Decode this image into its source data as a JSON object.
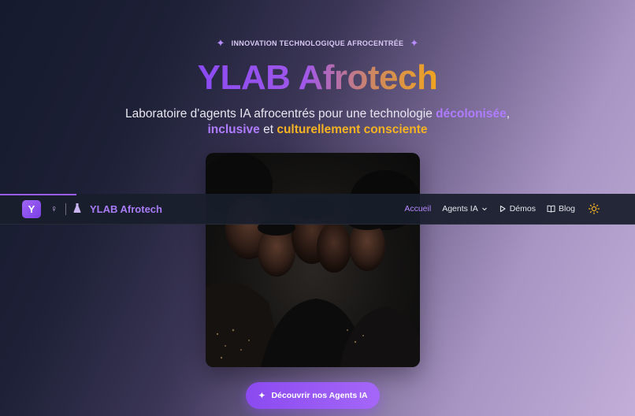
{
  "hero": {
    "eyebrow": "INNOVATION TECHNOLOGIQUE AFROCENTRÉE",
    "title": "YLAB Afrotech",
    "subtitle_part1": "Laboratoire d'agents IA afrocentrés pour une technologie ",
    "subtitle_highlight1": "décolonisée",
    "subtitle_part2": ",",
    "subtitle_highlight2": "inclusive",
    "subtitle_part3": " et ",
    "subtitle_highlight3": "culturellement consciente",
    "image_alt": "Groupe de personnes africaines en clair-obscur",
    "cta_label": "Découvrir nos Agents IA",
    "cta_icon": "sparkles-icon"
  },
  "navbar": {
    "logo_letter": "Y",
    "icon_female": "♀",
    "icon_flask": "♟",
    "brand": "YLAB Afrotech",
    "links": [
      {
        "label": "Accueil",
        "active": true
      },
      {
        "label": "Agents IA",
        "icon": "chevron-down-icon"
      },
      {
        "label": "Démos",
        "icon": "play-icon"
      },
      {
        "label": "Blog",
        "icon": "book-icon"
      }
    ],
    "theme_icon": "sun-icon",
    "scroll_progress": 0.12
  },
  "colors": {
    "accent": "#9a5cf6",
    "amber": "#f5b323",
    "nav_bg": "#191e2c"
  }
}
